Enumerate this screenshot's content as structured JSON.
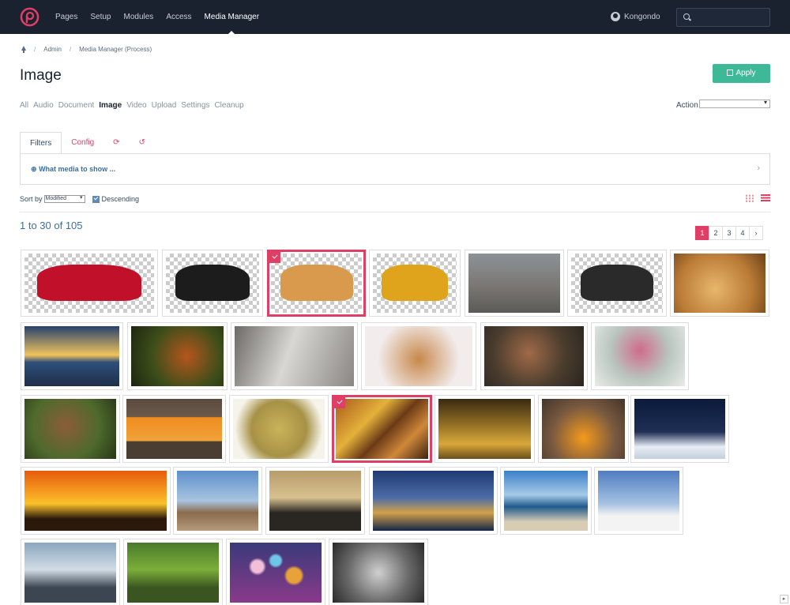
{
  "nav": {
    "items": [
      {
        "label": "Pages"
      },
      {
        "label": "Setup"
      },
      {
        "label": "Modules"
      },
      {
        "label": "Access"
      },
      {
        "label": "Media Manager"
      }
    ],
    "active": "Media Manager",
    "user": "Kongondo",
    "search_placeholder": ""
  },
  "breadcrumb": {
    "items": [
      "Admin",
      "Media Manager (Process)"
    ]
  },
  "page": {
    "title": "Image",
    "apply_label": "Apply"
  },
  "media_types": [
    "All",
    "Audio",
    "Document",
    "Image",
    "Video",
    "Upload",
    "Settings",
    "Cleanup"
  ],
  "active_type": "Image",
  "action": {
    "label": "Action",
    "value": ""
  },
  "tabs": {
    "filters": "Filters",
    "config": "Config"
  },
  "filters": {
    "link": "What media to show ..."
  },
  "sort": {
    "label": "Sort by",
    "value": "Modified",
    "descending_label": "Descending",
    "descending_checked": true
  },
  "results": {
    "count_text": "1 to 30 of 105"
  },
  "pagination": {
    "pages": [
      "1",
      "2",
      "3",
      "4"
    ],
    "current": "1",
    "next": "›"
  },
  "thumbnails": [
    {
      "subject": "red-car",
      "selected": false
    },
    {
      "subject": "steam-locomotive",
      "selected": false
    },
    {
      "subject": "bread-loaf",
      "selected": true
    },
    {
      "subject": "coffee-cup",
      "selected": false
    },
    {
      "subject": "stone-house",
      "selected": false
    },
    {
      "subject": "bicycle",
      "selected": false
    },
    {
      "subject": "bread-rolls",
      "selected": false
    },
    {
      "subject": "sunset-pier",
      "selected": false
    },
    {
      "subject": "squirrel",
      "selected": false
    },
    {
      "subject": "swan",
      "selected": false
    },
    {
      "subject": "waffles-berries",
      "selected": false
    },
    {
      "subject": "woman-portrait",
      "selected": false
    },
    {
      "subject": "flowers-snow",
      "selected": false
    },
    {
      "subject": "spider",
      "selected": false
    },
    {
      "subject": "orange-halves",
      "selected": false
    },
    {
      "subject": "coins",
      "selected": false
    },
    {
      "subject": "abstract-painting",
      "selected": true
    },
    {
      "subject": "autumn-avenue",
      "selected": false
    },
    {
      "subject": "fruit-faces",
      "selected": false
    },
    {
      "subject": "winter-forest",
      "selected": false
    },
    {
      "subject": "safari-sunset",
      "selected": false
    },
    {
      "subject": "old-boat",
      "selected": false
    },
    {
      "subject": "rio-skyline",
      "selected": false
    },
    {
      "subject": "tower-bridge",
      "selected": false
    },
    {
      "subject": "beach-sea",
      "selected": false
    },
    {
      "subject": "snowy-church",
      "selected": false
    },
    {
      "subject": "winter-town",
      "selected": false
    },
    {
      "subject": "watermill",
      "selected": false
    },
    {
      "subject": "bokeh-lights",
      "selected": false
    },
    {
      "subject": "mother-child",
      "selected": false
    }
  ],
  "colors": {
    "accent": "#e03f65",
    "apply": "#3eb998",
    "nav_bg": "#1a2230",
    "link": "#3d6e9f"
  }
}
